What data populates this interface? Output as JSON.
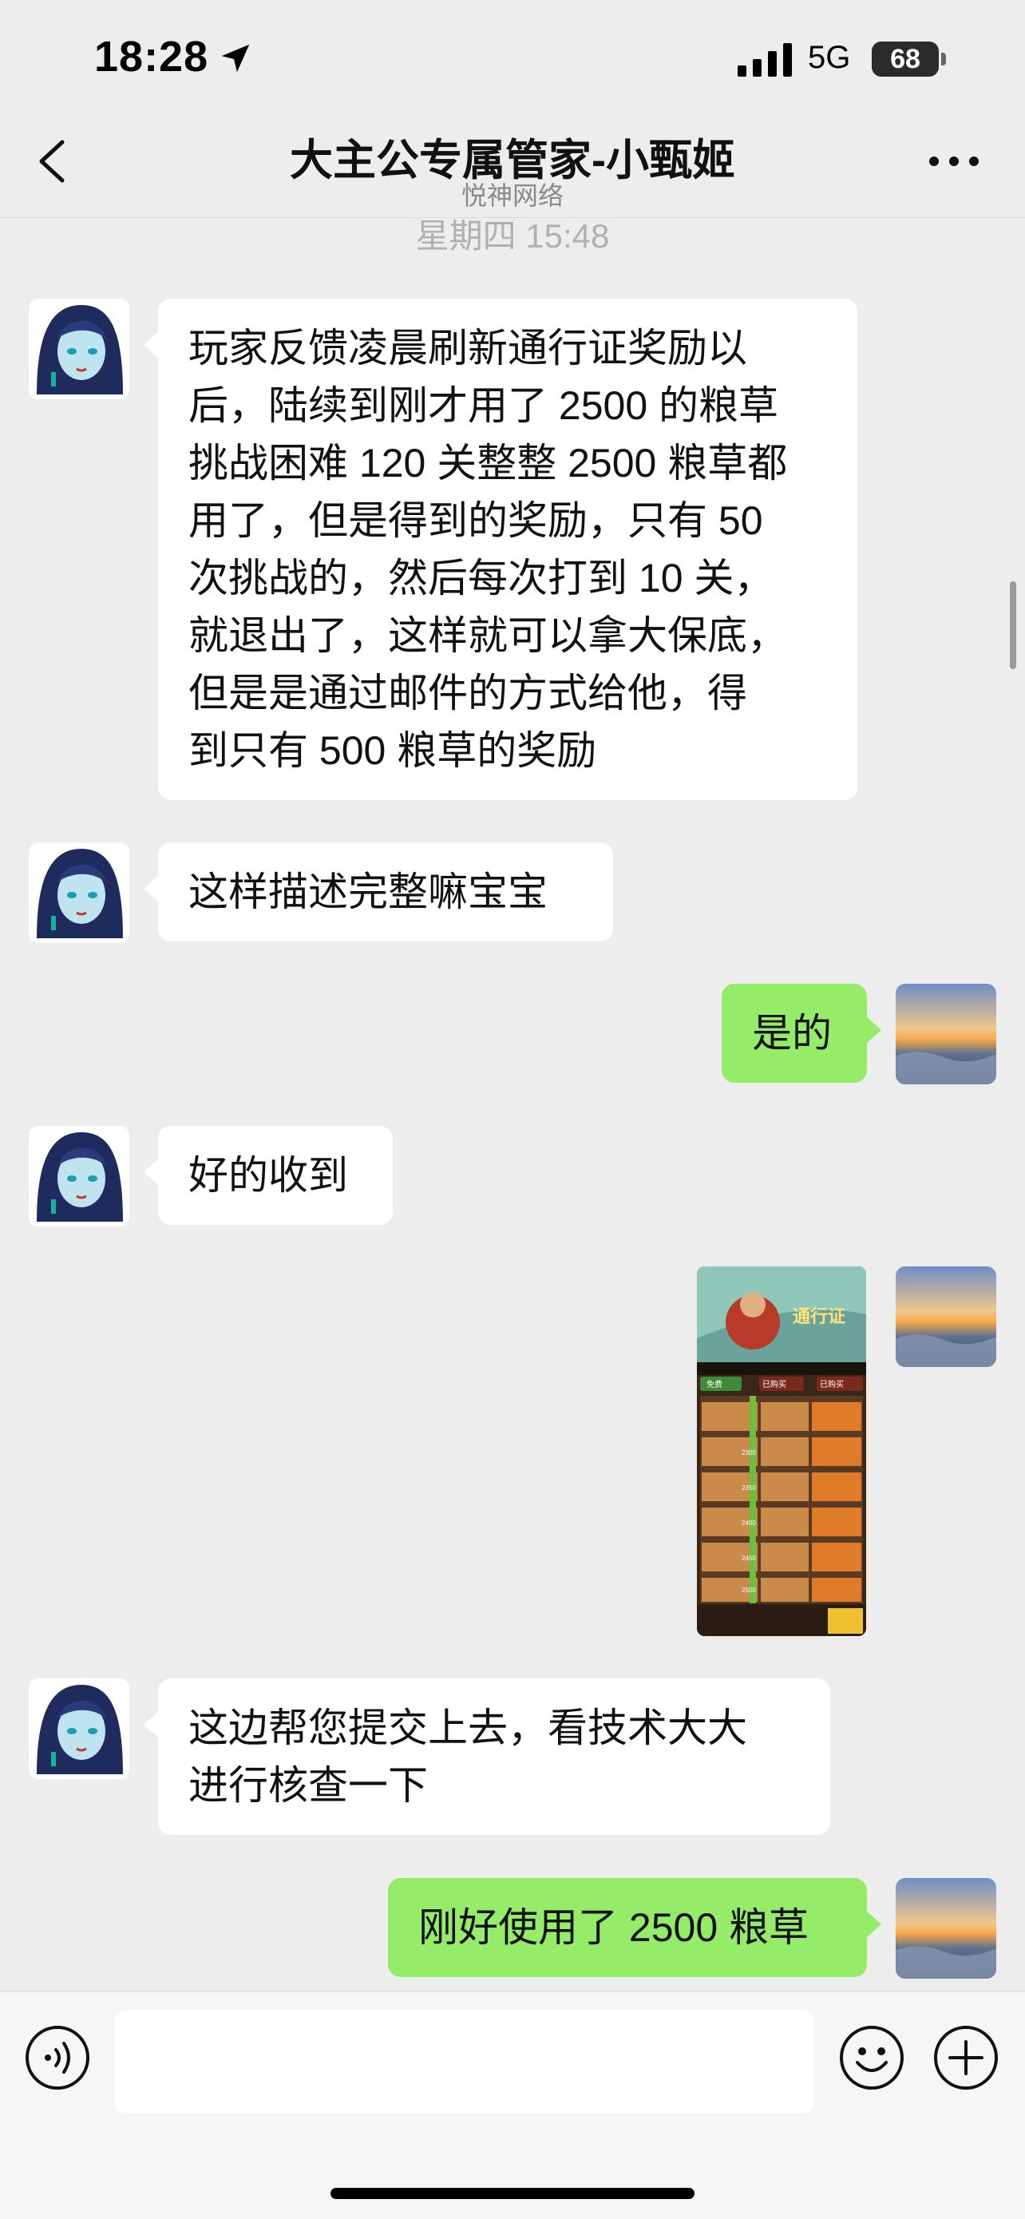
{
  "status_bar": {
    "time": "18:28",
    "network": "5G",
    "battery": "68"
  },
  "header": {
    "title": "大主公专属管家-小甄姬",
    "subtitle": "悦神网络"
  },
  "timestamp": "星期四 15:48",
  "messages": [
    {
      "sender": "agent",
      "text": "玩家反馈凌晨刷新通行证奖励以\n后，陆续到刚才用了 2500 的粮草\n挑战困难 120 关整整 2500 粮草都\n用了，但是得到的奖励，只有 50\n次挑战的，然后每次打到 10 关，\n就退出了，这样就可以拿大保底，\n但是是通过邮件的方式给他，得\n到只有 500 粮草的奖励"
    },
    {
      "sender": "agent",
      "text": "这样描述完整嘛宝宝"
    },
    {
      "sender": "me",
      "text": "是的"
    },
    {
      "sender": "agent",
      "text": "好的收到"
    },
    {
      "sender": "me",
      "type": "image",
      "caption_lines": [
        "通行证",
        "免费",
        "已购买",
        "已购买"
      ],
      "ranks": [
        "2300",
        "2350",
        "2400",
        "2450",
        "2500"
      ]
    },
    {
      "sender": "agent",
      "text": "这边帮您提交上去，看技术大大\n进行核查一下"
    },
    {
      "sender": "me",
      "text": "刚好使用了 2500 粮草"
    }
  ],
  "input": {
    "placeholder": ""
  },
  "colors": {
    "background": "#ededed",
    "bubble_out": "#95ec69",
    "bubble_in": "#ffffff"
  },
  "icons": [
    "location-arrow-icon",
    "signal-icon",
    "battery-icon",
    "back-icon",
    "more-icon",
    "voice-icon",
    "emoji-icon",
    "plus-icon"
  ]
}
